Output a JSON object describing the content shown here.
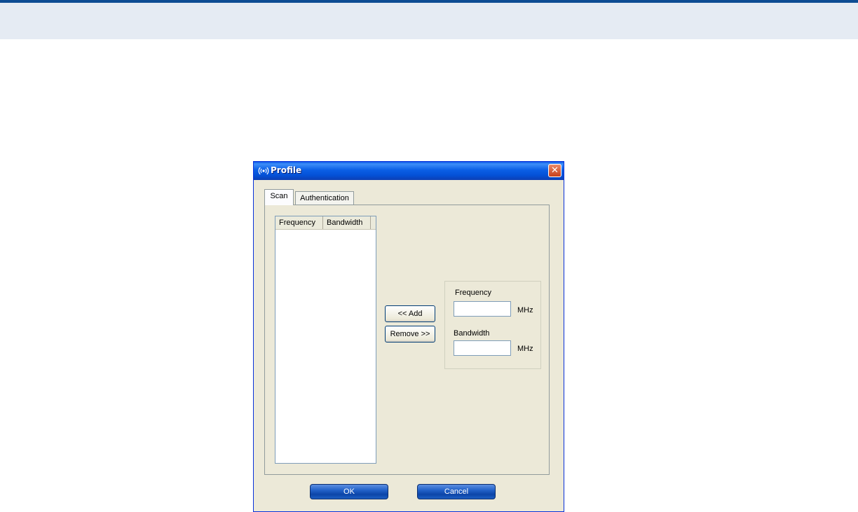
{
  "dialog": {
    "title": "Profile",
    "tabs": [
      {
        "label": "Scan",
        "selected": true
      },
      {
        "label": "Authentication",
        "selected": false
      }
    ],
    "list": {
      "columns": [
        "Frequency",
        "Bandwidth"
      ],
      "rows": []
    },
    "buttons": {
      "add": "<< Add",
      "remove": "Remove >>",
      "ok": "OK",
      "cancel": "Cancel"
    },
    "fields": {
      "frequency_label": "Frequency",
      "frequency_value": "",
      "frequency_unit": "MHz",
      "bandwidth_label": "Bandwidth",
      "bandwidth_value": "",
      "bandwidth_unit": "MHz"
    }
  },
  "colors": {
    "titlebar": "#0b5fe6",
    "dialog_bg": "#ece9d8",
    "page_band": "#e5ebf3",
    "page_band_border": "#0d4c93"
  },
  "icons": {
    "title": "wireless-signal-icon",
    "close": "close-icon"
  }
}
